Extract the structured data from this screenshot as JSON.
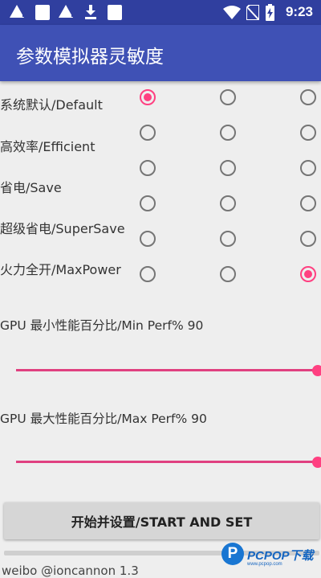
{
  "status_bar": {
    "time": "9:23",
    "icons": [
      "warning-icon",
      "square-icon",
      "warning-icon",
      "download-icon",
      "square-icon",
      "wifi-icon",
      "no-sim-icon",
      "battery-charging-icon"
    ]
  },
  "app": {
    "title": "参数模拟器灵敏度",
    "bar_color": "#3f51b5",
    "accent_color": "#ff4081"
  },
  "modes": {
    "rows": [
      {
        "label": "系统默认/Default",
        "selected_column": 0
      },
      {
        "label": "高效率/Efficient",
        "selected_column": null
      },
      {
        "label": "省电/Save",
        "selected_column": null
      },
      {
        "label": "超级省电/SuperSave",
        "selected_column": null
      },
      {
        "label": "火力全开/MaxPower",
        "selected_column": 2
      }
    ],
    "extra_radio_row_after": 2
  },
  "sliders": {
    "min_perf": {
      "label": "GPU 最小性能百分比/Min Perf% 90",
      "value_percent": 90,
      "fill_fraction": 1.0
    },
    "max_perf": {
      "label": "GPU 最大性能百分比/Max Perf% 90",
      "value_percent": 90,
      "fill_fraction": 1.0
    }
  },
  "start_button": {
    "label": "开始并设置/START AND SET"
  },
  "footer": {
    "text": "weibo @ioncannon 1.3"
  },
  "watermark": {
    "logo": "P",
    "text": "PCPOP下载",
    "subtext": "www.pcpop.com"
  }
}
